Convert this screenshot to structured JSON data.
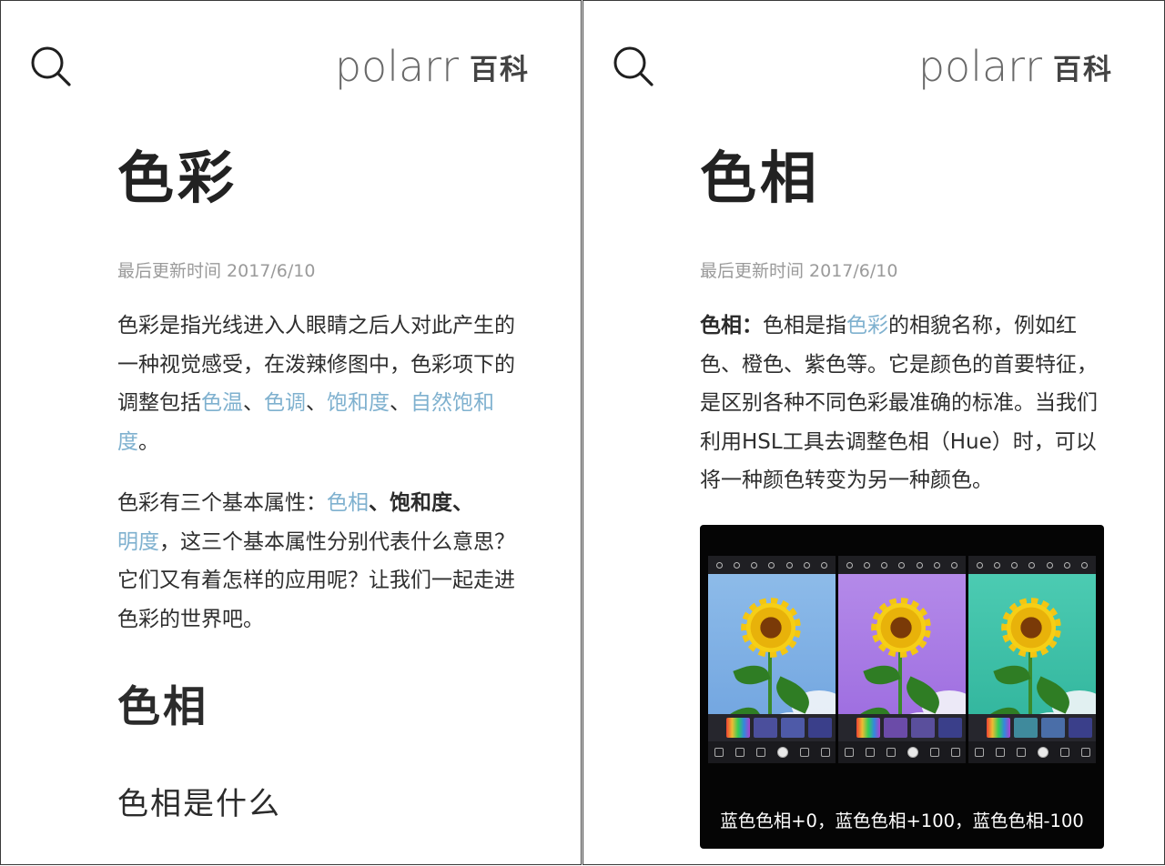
{
  "header": {
    "logo_word": "polarr",
    "logo_suffix": "百科",
    "search_icon": "search-icon"
  },
  "left": {
    "title": "色彩",
    "updated": "最后更新时间 2017/6/10",
    "intro_plain": "色彩是指光线进入人眼睛之后人对此产生的一种视觉感受，在泼辣修图中，色彩项下的调整包括",
    "intro_links": [
      "色温",
      "色调",
      "饱和度",
      "自然饱和度"
    ],
    "intro_sep": "、",
    "intro_end": "。",
    "attr_prefix": "色彩有三个基本属性：",
    "attr_link1": "色相",
    "attr_sep": "、",
    "attr_bold": "饱和度",
    "attr_link2": "明度",
    "attr_rest": "，这三个基本属性分别代表什么意思？它们又有着怎样的应用呢？让我们一起走进色彩的世界吧。",
    "section_title": "色相",
    "subsection_title": "色相是什么"
  },
  "right": {
    "title": "色相",
    "updated": "最后更新时间 2017/6/10",
    "def_term": "色相",
    "def_colon": "：",
    "def_a": "色相是指",
    "def_link": "色彩",
    "def_b": "的相貌名称，例如红色、橙色、紫色等。它是颜色的首要特征，是区别各种不同色彩最准确的标准。当我们利用HSL工具去调整色相（Hue）时，可以将一种颜色转变为另一种颜色。",
    "figure_caption": "蓝色色相+0，蓝色色相+100，蓝色色相-100"
  },
  "colors": {
    "link": "#7fb1cf",
    "text": "#2e2e2e",
    "meta": "#9a9a9a",
    "sky_blue": "#7fb0e4",
    "sky_purple": "#a476e4",
    "sky_teal": "#36bfa6"
  }
}
